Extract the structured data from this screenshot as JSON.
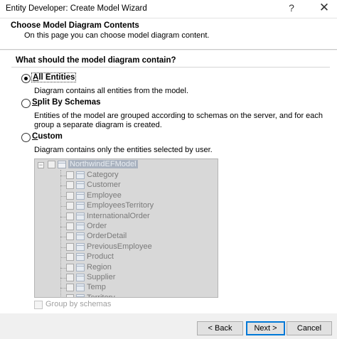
{
  "window": {
    "title": "Entity Developer: Create Model Wizard",
    "help": "?",
    "close": "✕"
  },
  "header": {
    "title": "Choose Model Diagram Contents",
    "subtitle": "On this page you can choose model diagram content."
  },
  "question": "What should the model diagram contain?",
  "options": [
    {
      "label": "All Entities",
      "selected": true,
      "description": "Diagram contains all entities from the model."
    },
    {
      "label": "Split By Schemas",
      "selected": false,
      "description": "Entities of the model are grouped according to schemas on the server, and for each group a separate diagram is created."
    },
    {
      "label": "Custom",
      "selected": false,
      "description": "Diagram contains only the entities selected by user."
    }
  ],
  "tree": {
    "root": "NorthwindEFModel",
    "items": [
      "Category",
      "Customer",
      "Employee",
      "EmployeesTerritory",
      "InternationalOrder",
      "Order",
      "OrderDetail",
      "PreviousEmployee",
      "Product",
      "Region",
      "Supplier",
      "Temp",
      "Territory"
    ]
  },
  "group_by_schemas": {
    "label": "Group by schemas",
    "checked": false
  },
  "buttons": {
    "back": "< Back",
    "next": "Next >",
    "cancel": "Cancel"
  }
}
